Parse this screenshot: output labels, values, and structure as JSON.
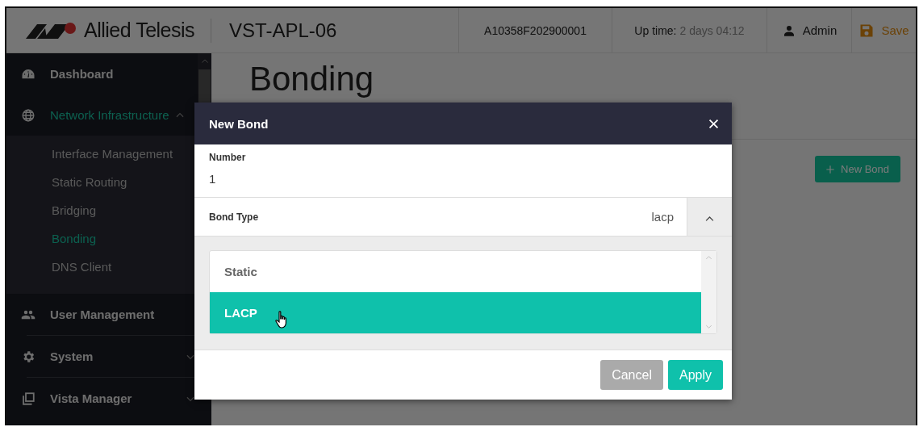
{
  "header": {
    "brand": "Allied Telesis",
    "device": "VST-APL-06",
    "serial": "A10358F202900001",
    "uptime": {
      "label": "Up time:",
      "value": "2 days 04:12"
    },
    "user": "Admin",
    "save": "Save"
  },
  "sidebar": {
    "items": [
      {
        "kind": "link",
        "label": "Dashboard",
        "selected": false
      },
      {
        "kind": "group",
        "label": "Network Infrastructure",
        "selected": true,
        "expanded": true,
        "children": [
          {
            "label": "Interface Management",
            "selected": false
          },
          {
            "label": "Static Routing",
            "selected": false
          },
          {
            "label": "Bridging",
            "selected": false
          },
          {
            "label": "Bonding",
            "selected": true
          },
          {
            "label": "DNS Client",
            "selected": false
          }
        ]
      },
      {
        "kind": "link",
        "label": "User Management",
        "selected": false
      },
      {
        "kind": "group",
        "label": "System",
        "selected": false,
        "expanded": false
      },
      {
        "kind": "group",
        "label": "Vista Manager",
        "selected": false,
        "expanded": false
      }
    ]
  },
  "page": {
    "title": "Bonding",
    "new_button": "New Bond"
  },
  "dialog": {
    "title": "New Bond",
    "number": {
      "label": "Number",
      "value": "1"
    },
    "bond_type": {
      "label": "Bond Type",
      "value": "lacp",
      "expanded": true,
      "options": [
        {
          "label": "Static",
          "selected": false
        },
        {
          "label": "LACP",
          "selected": true
        }
      ]
    },
    "buttons": [
      {
        "kind": "secondary",
        "label": "Cancel"
      },
      {
        "kind": "primary",
        "label": "Apply"
      }
    ]
  }
}
